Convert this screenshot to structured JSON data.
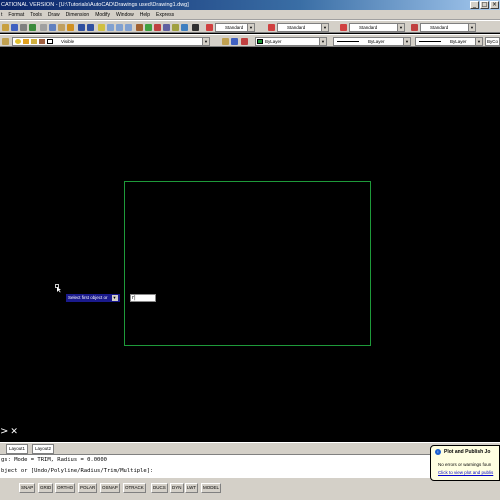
{
  "window": {
    "title": "CATIONAL VERSION - [U:\\Tutorials\\AutoCAD\\Drawings used\\Drawing1.dwg]"
  },
  "menu": {
    "items": [
      "t",
      "Format",
      "Tools",
      "Draw",
      "Dimension",
      "Modify",
      "Window",
      "Help",
      "Express"
    ]
  },
  "toolbar_top": {
    "text_style": "Standard",
    "dim_style": "Standard",
    "table_style": "Standard"
  },
  "toolbar_layers": {
    "layer": "Visible",
    "color": "ByLayer",
    "linetype": "ByLayer",
    "lineweight": "ByLayer",
    "plotstyle": "ByCo"
  },
  "canvas": {
    "prompt_tooltip": "Select first object or",
    "dynamic_input_value": "r|"
  },
  "layout_tabs": [
    "Layout1",
    "Layout2"
  ],
  "command_line": [
    "gs: Mode = TRIM, Radius = 0.0000",
    "bject or [Undo/Polyline/Radius/Trim/Multiple]:"
  ],
  "status_buttons": [
    "SNAP",
    "GRID",
    "ORTHO",
    "POLAR",
    "OSNAP",
    "OTRACK",
    "DUCS",
    "DYN",
    "LWT",
    "MODEL"
  ],
  "notification": {
    "title": "Plot and Publish Jo",
    "line1": "No errors or warnings foun",
    "link": "Click to view plot and publis"
  },
  "colors": {
    "rectangle_stroke": "#1e9a3a",
    "canvas_bg": "#000000",
    "tooltip_bg": "#1a1a8c"
  }
}
